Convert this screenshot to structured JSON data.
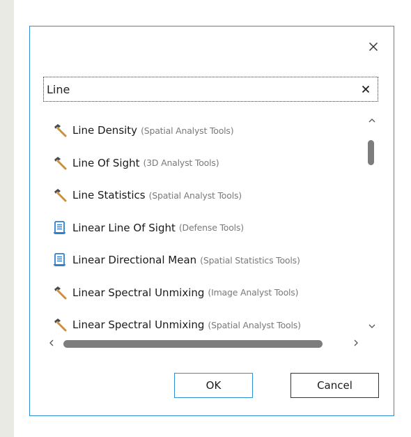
{
  "dialog": {
    "close_glyph": "×"
  },
  "search": {
    "value": "Line",
    "clear_glyph": "×"
  },
  "results": [
    {
      "name": "Line Density",
      "toolbox": "(Spatial Analyst Tools)",
      "icon": "hammer-icon"
    },
    {
      "name": "Line Of Sight",
      "toolbox": "(3D Analyst Tools)",
      "icon": "hammer-icon"
    },
    {
      "name": "Line Statistics",
      "toolbox": "(Spatial Analyst Tools)",
      "icon": "hammer-icon"
    },
    {
      "name": "Linear Line Of Sight",
      "toolbox": "(Defense Tools)",
      "icon": "script-icon"
    },
    {
      "name": "Linear Directional Mean",
      "toolbox": "(Spatial Statistics Tools)",
      "icon": "script-icon"
    },
    {
      "name": "Linear Spectral Unmixing",
      "toolbox": "(Image Analyst Tools)",
      "icon": "hammer-icon"
    },
    {
      "name": "Linear Spectral Unmixing",
      "toolbox": "(Spatial Analyst Tools)",
      "icon": "hammer-icon"
    }
  ],
  "buttons": {
    "ok_label": "OK",
    "cancel_label": "Cancel"
  },
  "colors": {
    "accent": "#2f8fd6",
    "hammer_handle": "#c9903f",
    "hammer_head": "#4a4a4a",
    "script_icon": "#2f7fd0"
  }
}
